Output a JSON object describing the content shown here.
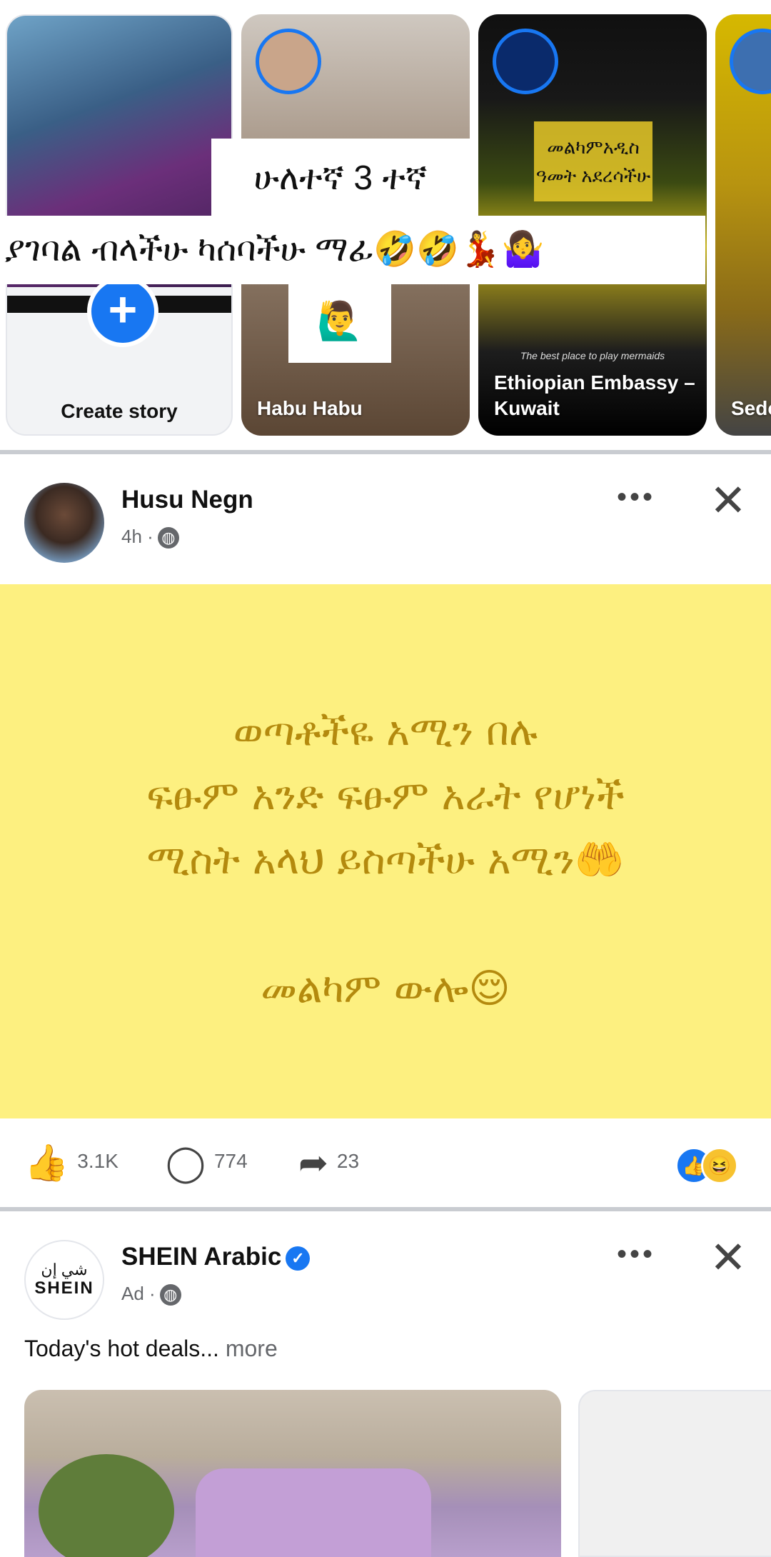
{
  "stories": {
    "create_label": "Create story",
    "items": [
      {
        "name": "Habu Habu"
      },
      {
        "name": "Ethiopian Embassy – Kuwait"
      },
      {
        "name": "Sedo"
      }
    ],
    "overlay_text_1": "ሁለተኛ 3 ተኛ",
    "overlay_text_2": "ያገባል ብላችሁ ካሰባችሁ ማፊ🤣🤣💃🤷‍♀️",
    "overlay_text_3": "🙋‍♂️",
    "embassy_card_text": "መልካምአዲስ ዓመት አደረሳችሁ",
    "embassy_card_subtext": "The best place to play mermaids"
  },
  "post1": {
    "author": "Husu Negn",
    "time": "4h ·",
    "body": "ወጣቶችዬ አሚን በሉ\nፍፁም አንድ ፍፁም አራት የሆነች\nሚስት አላህ ይስጣችሁ አሚን🤲\n\nመልካም ውሎ😌",
    "likes": "3.1K",
    "comments": "774",
    "shares": "23"
  },
  "post2": {
    "author": "SHEIN Arabic",
    "meta": "Ad ·",
    "text": "Today's hot deals...",
    "more_label": "more",
    "logo_ar": "شي إن",
    "logo_en": "SHEIN"
  },
  "icons": {
    "more": "•••",
    "close": "✕",
    "like": "👍",
    "comment": "◯",
    "share": "➦",
    "globe": "🌐",
    "verified": "✓",
    "plus": "+"
  },
  "colors": {
    "accent": "#1877f2",
    "post_bg": "#fdf080",
    "post_text": "#b48a0e"
  }
}
